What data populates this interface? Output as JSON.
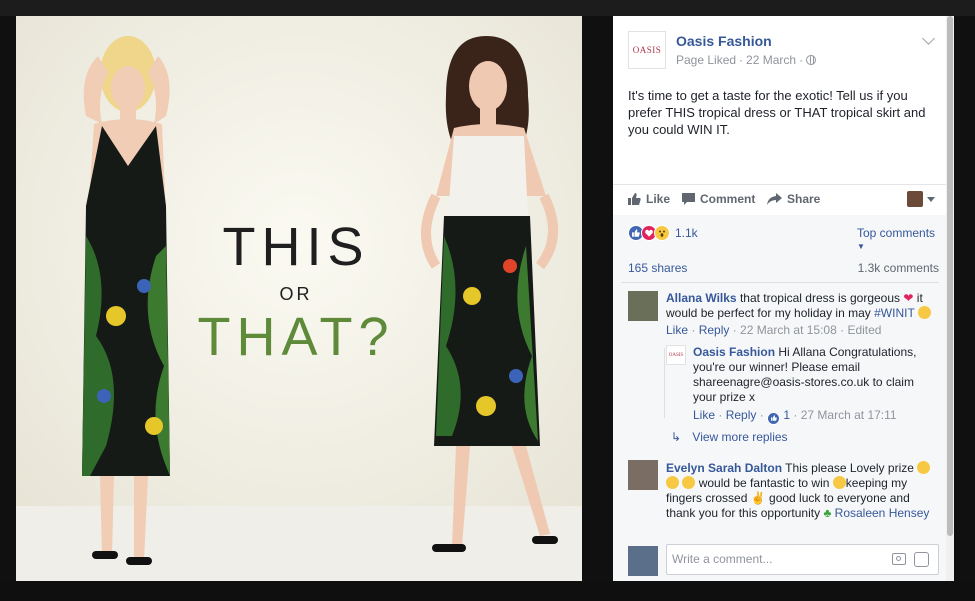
{
  "ad": {
    "word1": "THIS",
    "word2": "OR",
    "word3": "THAT?"
  },
  "post": {
    "page_name": "Oasis Fashion",
    "logo_text": "OASIS",
    "meta_liked": "Page Liked",
    "meta_sep": "·",
    "meta_date": "22 March",
    "text": "It's time to get a taste for the exotic! Tell us if you prefer THIS tropical dress or THAT tropical skirt and you could WIN IT."
  },
  "actions": {
    "like": "Like",
    "comment": "Comment",
    "share": "Share"
  },
  "stats": {
    "reactions_count": "1.1k",
    "top_comments": "Top comments",
    "shares": "165 shares",
    "comments": "1.3k comments"
  },
  "comments": [
    {
      "name": "Allana Wilks",
      "text_a": "that tropical dress is gorgeous",
      "text_b": "it would be perfect for my holiday in may",
      "hashtag": "#WINIT",
      "like": "Like",
      "reply": "Reply",
      "time": "22 March at 15:08",
      "edited": "Edited"
    },
    {
      "name": "Evelyn Sarah Dalton",
      "text_a": "This please Lovely prize",
      "text_b": "would be fantastic to win",
      "text_c": "keeping my fingers crossed",
      "text_d": "good luck to everyone and thank you for this opportunity",
      "tag": "Rosaleen Hensey"
    }
  ],
  "reply": {
    "name": "Oasis Fashion",
    "text": "Hi Allana Congratulations, you're our winner! Please email shareenagre@oasis-stores.co.uk to claim your prize x",
    "like": "Like",
    "reply": "Reply",
    "likes": "1",
    "time": "27 March at 17:11",
    "view_more": "View more replies"
  },
  "composer": {
    "placeholder": "Write a comment..."
  },
  "colors": {
    "link": "#365899",
    "like_blue": "#4267b2",
    "heart": "#e0245e",
    "ad_dark": "#1f1f1f",
    "ad_green": "#5e8a3a"
  }
}
